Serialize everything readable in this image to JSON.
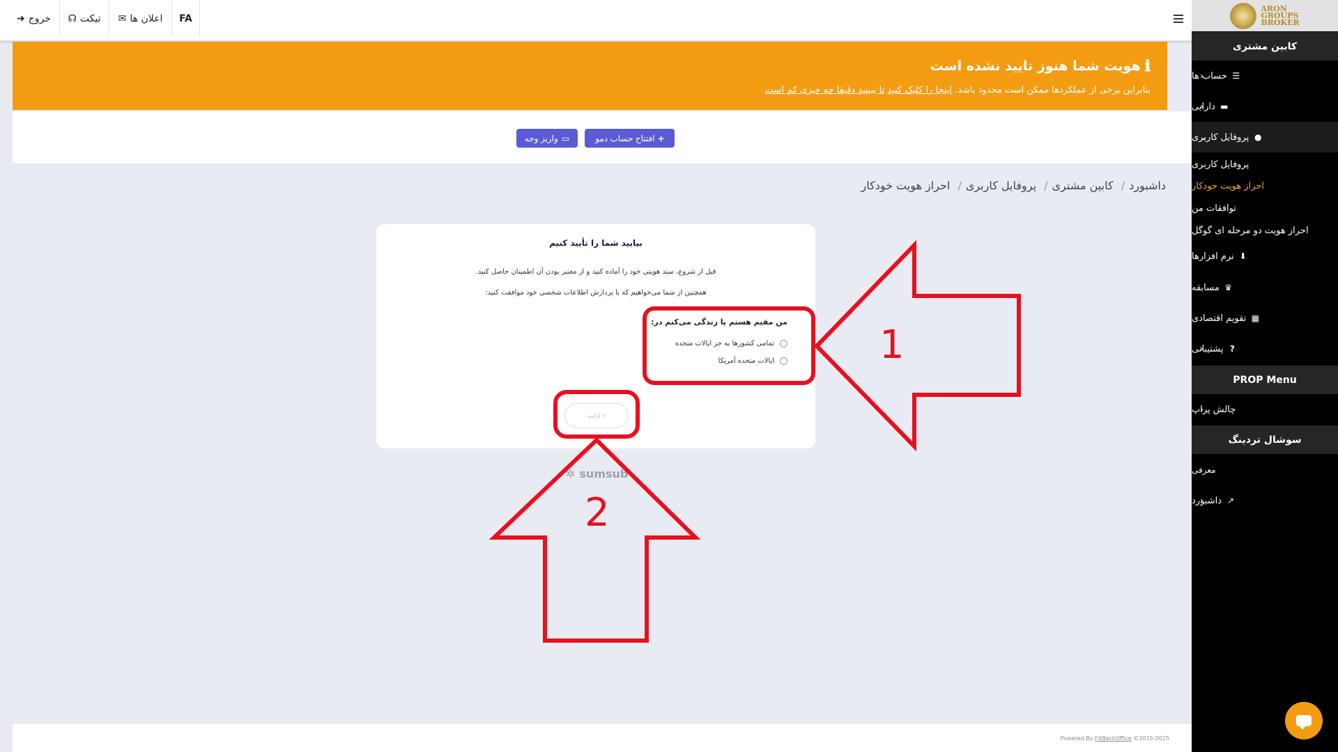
{
  "topbar": {
    "lang": "FA",
    "announcements": "اعلان ها",
    "ticket": "تیکت",
    "logout": "خروج"
  },
  "logo": {
    "line1": "ARON",
    "line2": "GROUPS",
    "line3": "BROKER"
  },
  "sidebar": {
    "header": "کابین مشتری",
    "accounts": "حساب ها",
    "assets": "دارایی",
    "profile": "پروفایل کاربری",
    "sub": {
      "profile": "پروفایل کاربری",
      "auto_kyc": "احراز هویت خودکار",
      "agreements": "توافقات من",
      "google_2fa": "احراز هویت دو مرحله ای گوگل"
    },
    "software": "نرم افزارها",
    "competition": "مسابقه",
    "calendar": "تقویم اقتصادی",
    "support": "پشتیبانی",
    "prop_header": "PROP Menu",
    "prop_challenge": "چالش پراپ",
    "social_header": "سوشال تردینگ",
    "intro": "معرفی",
    "dashboard": "داشبورد"
  },
  "alert": {
    "title": "هویت شما هنوز تایید نشده است",
    "text_prefix": "بنابراین برخی از عملکردها ممکن است محدود باشد.",
    "link1": "اینجا را کلیک کنید",
    "link2": "تا ببینید دقیقا چه چیزی کم است"
  },
  "actions": {
    "open_demo": "افتتاح حساب دمو",
    "deposit": "واریز وجه"
  },
  "breadcrumb": [
    "داشبورد",
    "کابین مشتری",
    "پروفایل کاربری",
    "احراز هویت خودکار"
  ],
  "card": {
    "title": "بیایید شما را تأیید کنیم",
    "p1": "قبل از شروع، سند هویتی خود را آماده کنید و از معتبر بودن آن اطمینان حاصل کنید.",
    "p2": "همچنین از شما می‌خواهیم که با پردازش اطلاعات شخصی خود موافقت کنید:",
    "question": "من مقیم هستم یا زندگی می‌کنم در:",
    "option1": "تمامی کشورها به جز ایالات متحده",
    "option2": "ایالات متحده آمریکا",
    "next": "ادامه >"
  },
  "sumsub": "sumsub",
  "footer": {
    "text": "Powered By",
    "link": "FXBackOffice",
    "year": "©2015-2025"
  },
  "annotations": {
    "arrow1": "1",
    "arrow2": "2"
  },
  "colors": {
    "accent": "#f39c12",
    "button": "#5b5bd6",
    "annotation": "#e8101f",
    "active_menu": "#f0a81a"
  }
}
